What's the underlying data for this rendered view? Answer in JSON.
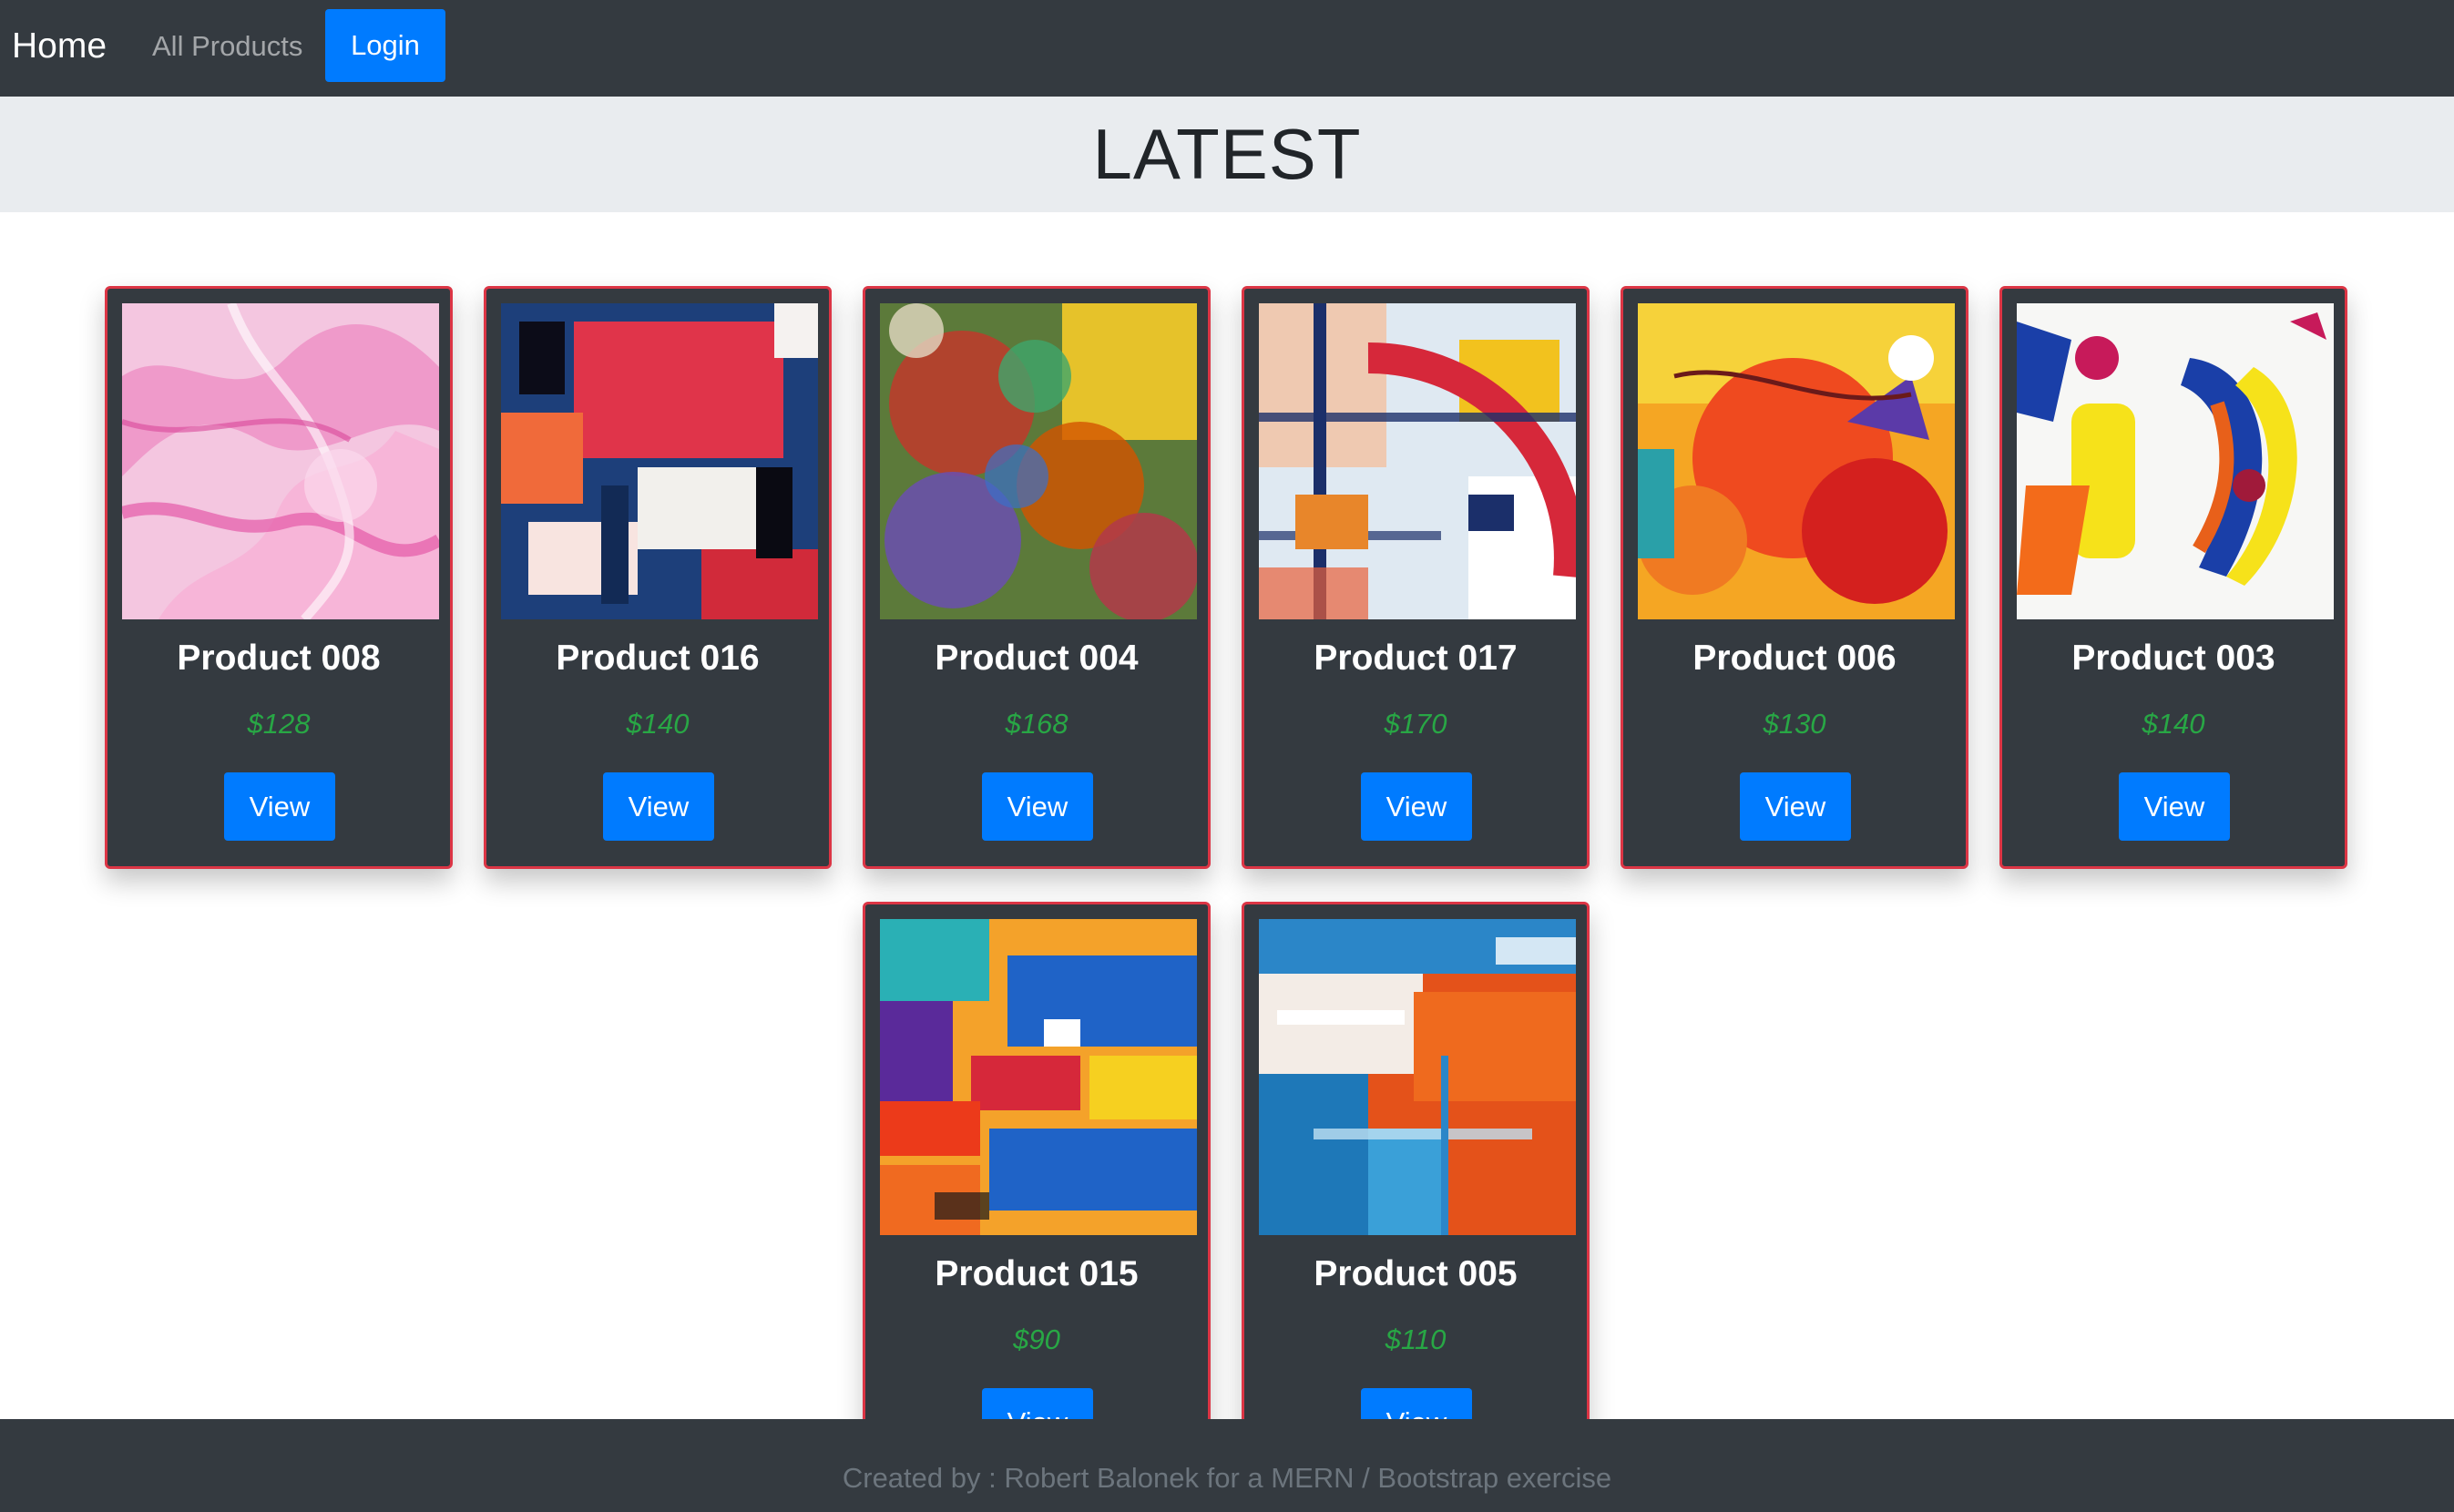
{
  "navbar": {
    "brand": "Home",
    "all_products": "All Products",
    "login": "Login"
  },
  "jumbotron": {
    "title": "LATEST"
  },
  "products": [
    {
      "name": "Product 008",
      "price": "$128",
      "button": "View",
      "art": "pink-marble"
    },
    {
      "name": "Product 016",
      "price": "$140",
      "button": "View",
      "art": "red-blue-abstract"
    },
    {
      "name": "Product 004",
      "price": "$168",
      "button": "View",
      "art": "multicolor-texture"
    },
    {
      "name": "Product 017",
      "price": "$170",
      "button": "View",
      "art": "red-arc-lines"
    },
    {
      "name": "Product 006",
      "price": "$130",
      "button": "View",
      "art": "orange-red-splash"
    },
    {
      "name": "Product 003",
      "price": "$140",
      "button": "View",
      "art": "yellow-blue-strokes"
    },
    {
      "name": "Product 015",
      "price": "$90",
      "button": "View",
      "art": "blocky-multicolor"
    },
    {
      "name": "Product 005",
      "price": "$110",
      "button": "View",
      "art": "orange-blue-white"
    }
  ],
  "footer": {
    "text": "Created by : Robert Balonek for a MERN / Bootstrap exercise"
  },
  "colors": {
    "navbar_bg": "#343a40",
    "primary": "#007bff",
    "card_border": "#dc3545",
    "price": "#28a745",
    "jumbotron_bg": "#e9ecef"
  }
}
